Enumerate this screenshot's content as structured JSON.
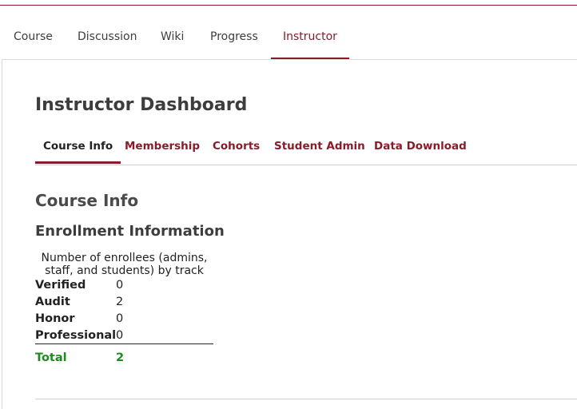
{
  "course_nav": {
    "tabs": [
      {
        "label": "Course"
      },
      {
        "label": "Discussion"
      },
      {
        "label": "Wiki"
      },
      {
        "label": "Progress"
      },
      {
        "label": "Instructor",
        "active": true
      }
    ]
  },
  "dashboard": {
    "title": "Instructor Dashboard",
    "tabs": [
      {
        "label": "Course Info",
        "active": true
      },
      {
        "label": "Membership"
      },
      {
        "label": "Cohorts"
      },
      {
        "label": "Student Admin"
      },
      {
        "label": "Data Download"
      }
    ]
  },
  "course_info": {
    "heading": "Course Info",
    "enrollment": {
      "heading": "Enrollment Information",
      "caption": "Number of enrollees (admins, staff, and students) by track",
      "rows": [
        {
          "label": "Verified",
          "value": "0"
        },
        {
          "label": "Audit",
          "value": "2"
        },
        {
          "label": "Honor",
          "value": "0"
        },
        {
          "label": "Professional",
          "value": "0"
        }
      ],
      "total": {
        "label": "Total",
        "value": "2"
      }
    }
  },
  "colors": {
    "accent": "#8b1a2b",
    "total": "#1f8a1f"
  }
}
